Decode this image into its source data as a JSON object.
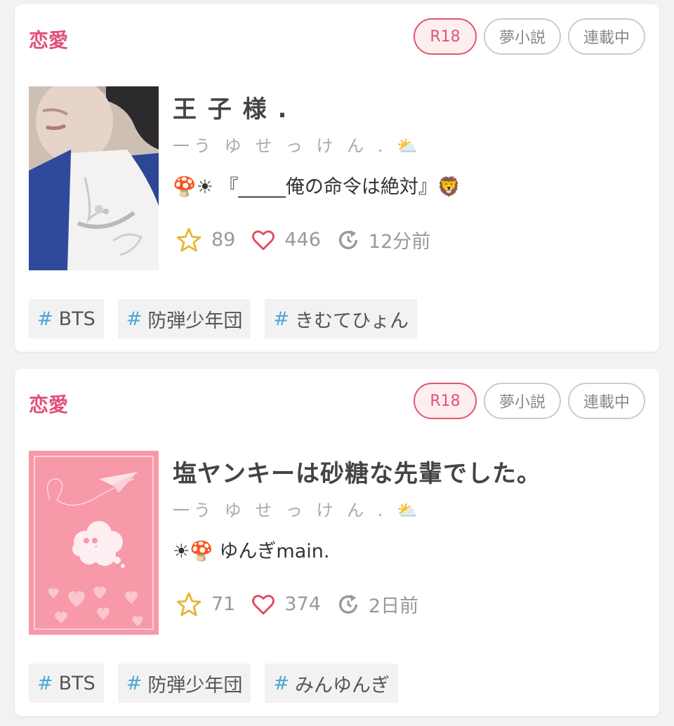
{
  "cards": [
    {
      "genre": "恋愛",
      "badges": {
        "r18": "R18",
        "type": "夢小説",
        "status": "連載中"
      },
      "title": "王 子 様 .",
      "author": "一う ゆ せ っ け ん . ⛅",
      "description": "🍄☀ 『_____俺の命令は絶対』🦁",
      "stats": {
        "stars": "89",
        "likes": "446",
        "updated": "12分前"
      },
      "tags": [
        "BTS",
        "防弾少年団",
        "きむてひょん"
      ]
    },
    {
      "genre": "恋愛",
      "badges": {
        "r18": "R18",
        "type": "夢小説",
        "status": "連載中"
      },
      "title": "塩ヤンキーは砂糖な先輩でした。",
      "author": "一う ゆ せ っ け ん . ⛅",
      "description": "☀🍄 ゆんぎmain.",
      "stats": {
        "stars": "71",
        "likes": "374",
        "updated": "2日前"
      },
      "tags": [
        "BTS",
        "防弾少年団",
        "みんゆんぎ"
      ]
    }
  ],
  "icons": {
    "star": "star-icon",
    "heart": "heart-icon",
    "updated": "refresh-clock-icon"
  },
  "colors": {
    "genre": "#e0517a",
    "r18": "#e0566f",
    "star": "#e8b731",
    "heart": "#e04a5c",
    "hash": "#4aa6d6"
  }
}
